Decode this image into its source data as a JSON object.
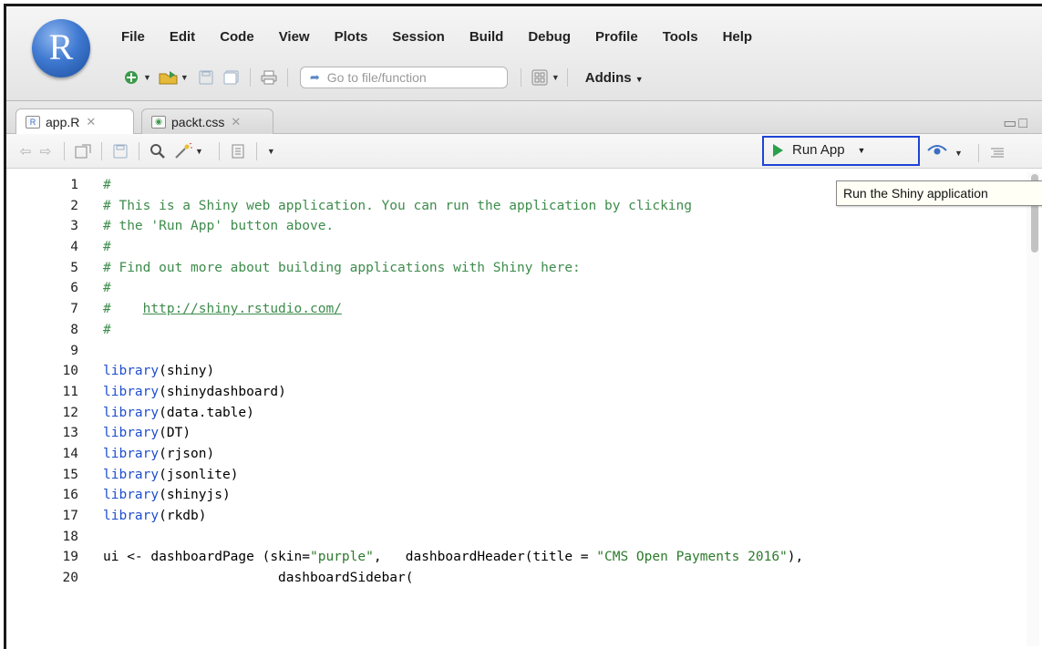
{
  "app": {
    "logo_letter": "R"
  },
  "menubar": [
    "File",
    "Edit",
    "Code",
    "View",
    "Plots",
    "Session",
    "Build",
    "Debug",
    "Profile",
    "Tools",
    "Help"
  ],
  "toolbar": {
    "goto_placeholder": "Go to file/function",
    "addins_label": "Addins"
  },
  "tabs": [
    {
      "label": "app.R",
      "icon": "r-file-icon",
      "active": true
    },
    {
      "label": "packt.css",
      "icon": "css-file-icon",
      "active": false
    }
  ],
  "editor_toolbar": {
    "run_app_label": "Run App",
    "tooltip": "Run the Shiny application"
  },
  "colors": {
    "comment": "#3d8c4b",
    "function": "#1f4fcf",
    "string": "#2c7a2c",
    "highlight_box": "#1f43d6",
    "run_icon": "#2aa04a"
  },
  "code": {
    "line_numbers": [
      "1",
      "2",
      "3",
      "4",
      "5",
      "6",
      "7",
      "8",
      "9",
      "10",
      "11",
      "12",
      "13",
      "14",
      "15",
      "16",
      "17",
      "18",
      "19",
      "20"
    ],
    "lines": [
      {
        "type": "comment",
        "text": "#"
      },
      {
        "type": "comment",
        "text": "# This is a Shiny web application. You can run the application by clicking"
      },
      {
        "type": "comment",
        "text": "# the 'Run App' button above."
      },
      {
        "type": "comment",
        "text": "#"
      },
      {
        "type": "comment",
        "text": "# Find out more about building applications with Shiny here:"
      },
      {
        "type": "comment",
        "text": "#"
      },
      {
        "type": "link",
        "prefix": "#    ",
        "text": "http://shiny.rstudio.com/"
      },
      {
        "type": "comment",
        "text": "#"
      },
      {
        "type": "blank",
        "text": ""
      },
      {
        "type": "call",
        "fn": "library",
        "arg": "shiny"
      },
      {
        "type": "call",
        "fn": "library",
        "arg": "shinydashboard"
      },
      {
        "type": "call",
        "fn": "library",
        "arg": "data.table"
      },
      {
        "type": "call",
        "fn": "library",
        "arg": "DT"
      },
      {
        "type": "call",
        "fn": "library",
        "arg": "rjson"
      },
      {
        "type": "call",
        "fn": "library",
        "arg": "jsonlite"
      },
      {
        "type": "call",
        "fn": "library",
        "arg": "shinyjs"
      },
      {
        "type": "call",
        "fn": "library",
        "arg": "rkdb"
      },
      {
        "type": "blank",
        "text": ""
      },
      {
        "type": "ui",
        "p1": "ui <- dashboardPage (skin=",
        "s1": "\"purple\"",
        "p2": ",   dashboardHeader(title = ",
        "s2": "\"CMS Open Payments 2016\"",
        "p3": "),"
      },
      {
        "type": "plain",
        "text": "                      dashboardSidebar("
      }
    ]
  }
}
